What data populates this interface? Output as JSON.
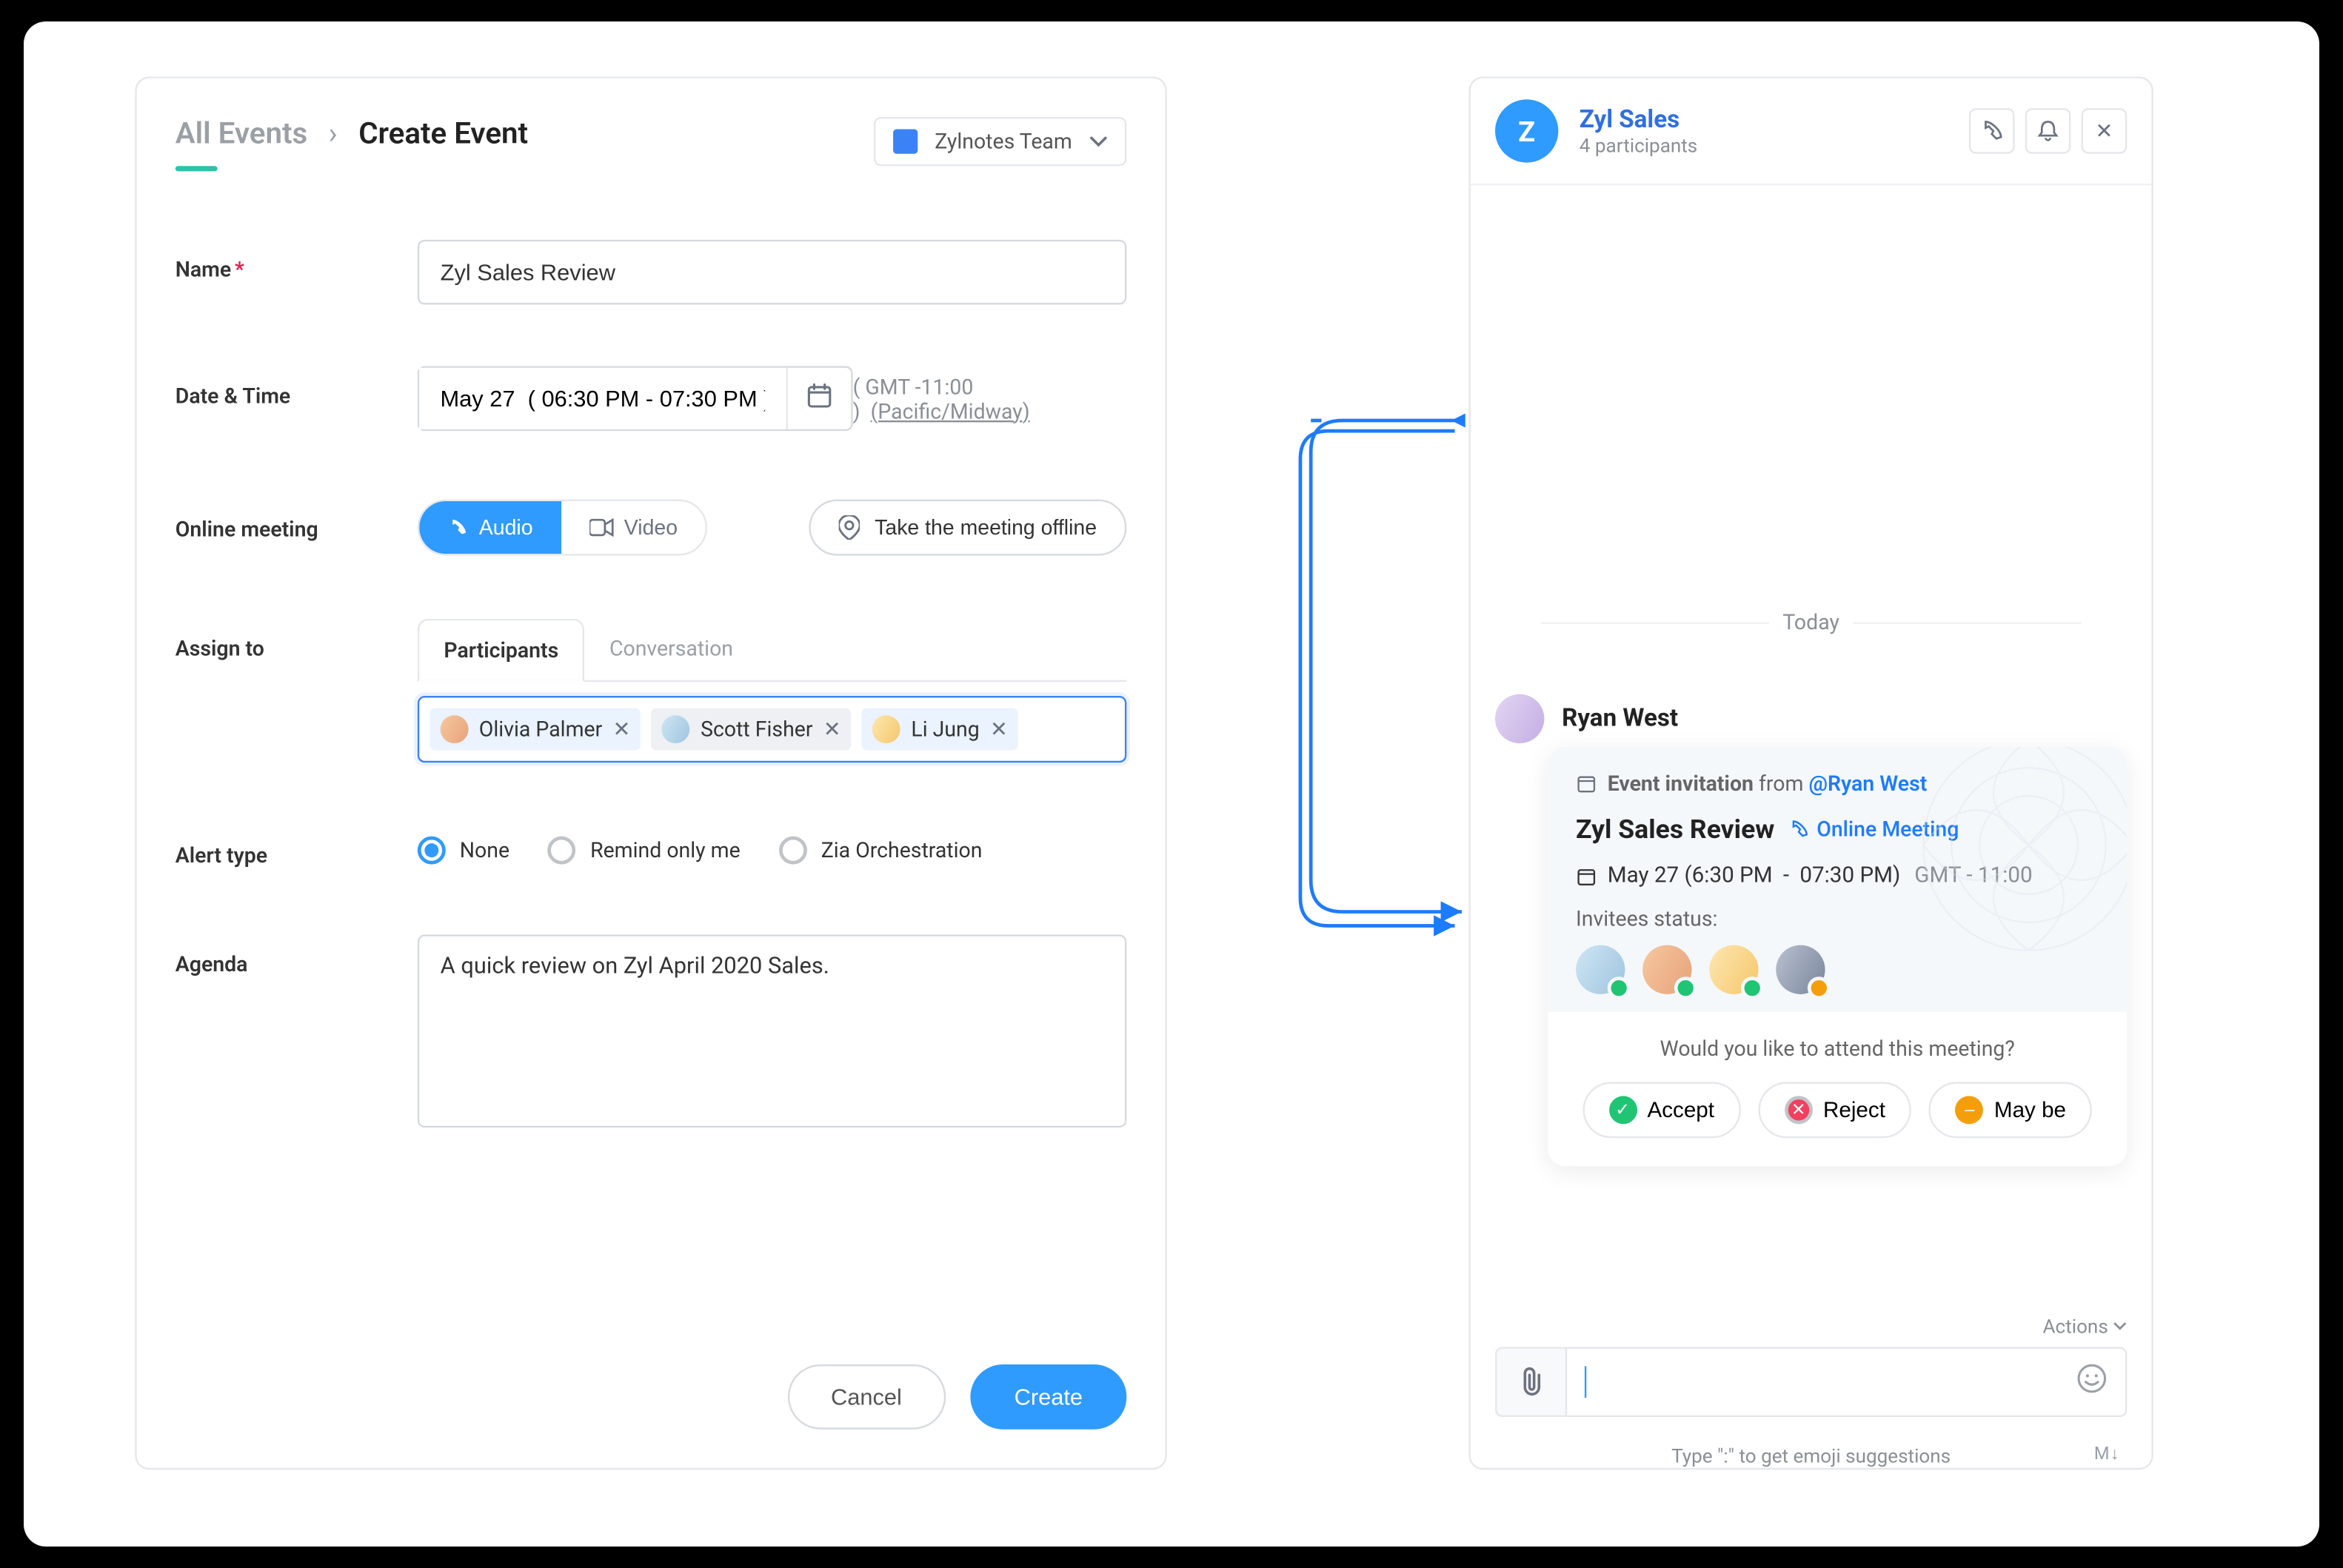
{
  "left": {
    "breadcrumb_prev": "All Events",
    "breadcrumb_current": "Create Event",
    "team_name": "Zylnotes Team",
    "labels": {
      "name": "Name",
      "date_time": "Date & Time",
      "online_meeting": "Online meeting",
      "assign_to": "Assign to",
      "alert_type": "Alert type",
      "agenda": "Agenda"
    },
    "name_value": "Zyl Sales Review",
    "date_value": "May 27  ( 06:30 PM - 07:30 PM )",
    "tz_offset": "( GMT -11:00 )",
    "tz_region": "(Pacific/Midway)",
    "audio_label": "Audio",
    "video_label": "Video",
    "offline_label": "Take the meeting offline",
    "tabs": {
      "participants": "Participants",
      "conversation": "Conversation"
    },
    "participants": [
      {
        "name": "Olivia Palmer"
      },
      {
        "name": "Scott Fisher"
      },
      {
        "name": "Li Jung"
      }
    ],
    "alerts": {
      "none": "None",
      "remind": "Remind only me",
      "zia": "Zia Orchestration"
    },
    "agenda_value": "A quick review on Zyl April 2020 Sales.",
    "cancel": "Cancel",
    "create": "Create"
  },
  "right": {
    "avatar_letter": "Z",
    "title": "Zyl Sales",
    "subtitle": "4 participants",
    "today": "Today",
    "sender": "Ryan West",
    "invite_prefix": "Event invitation",
    "invite_from": "from",
    "invite_user": "@Ryan West",
    "event_title": "Zyl Sales Review",
    "online_meeting": "Online Meeting",
    "dt_main": "May 27 (6:30 PM",
    "dt_sep": "-",
    "dt_end": "07:30 PM)",
    "gmt": "GMT - 11:00",
    "status_label": "Invitees status:",
    "question": "Would you like to attend this meeting?",
    "accept": "Accept",
    "reject": "Reject",
    "maybe": "May be",
    "actions": "Actions",
    "hint": "Type \":\" to get emoji suggestions",
    "md": "M↓"
  }
}
